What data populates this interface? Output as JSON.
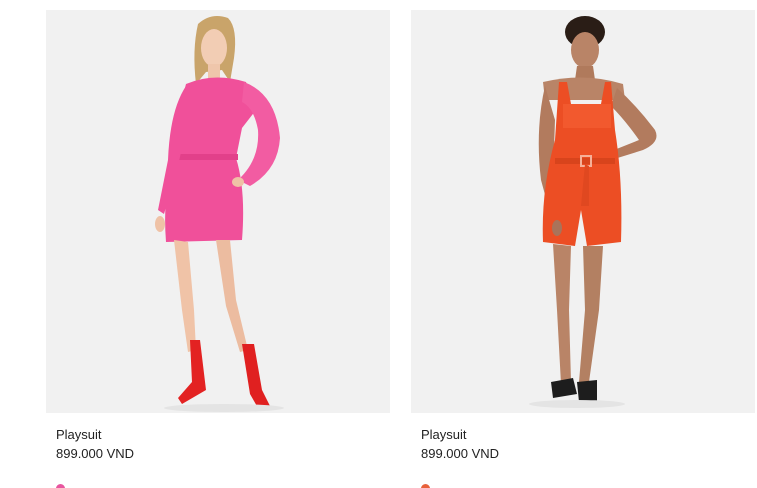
{
  "products": [
    {
      "name": "Playsuit",
      "price": "899.000 VND",
      "image_alt": "pink long-sleeve playsuit with red sock boots",
      "garment_color": "#f0509a",
      "swatch_color": "#e8559f"
    },
    {
      "name": "Playsuit",
      "price": "899.000 VND",
      "image_alt": "orange sleeveless playsuit with belt and black sandals",
      "garment_color": "#ec4e24",
      "swatch_color": "#e8613b"
    }
  ]
}
